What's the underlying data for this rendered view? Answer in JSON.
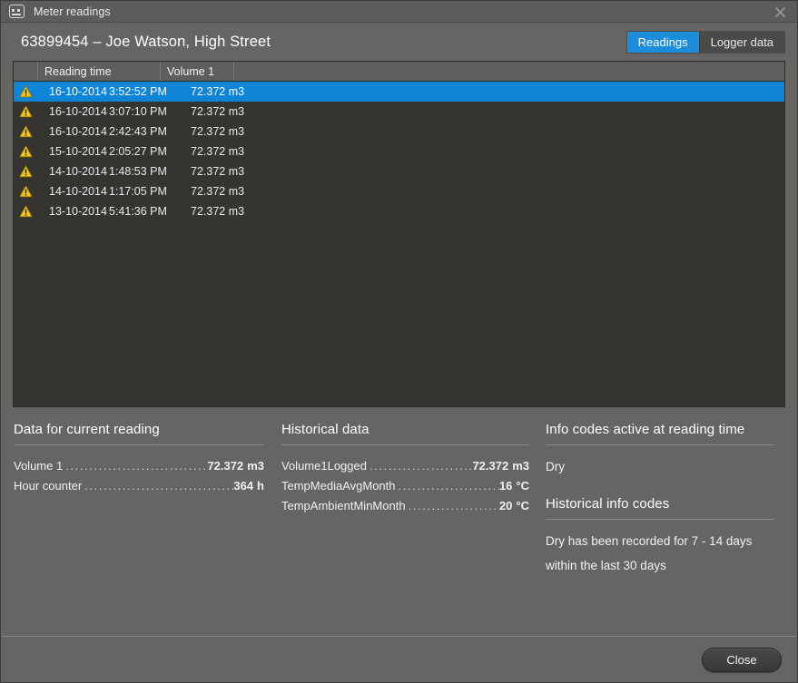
{
  "window": {
    "title": "Meter readings",
    "icon": "meter-icon",
    "close_icon": "close-icon"
  },
  "header": {
    "title": "63899454 – Joe Watson, High Street",
    "tabs": [
      {
        "label": "Readings",
        "active": true
      },
      {
        "label": "Logger data",
        "active": false
      }
    ]
  },
  "readings_table": {
    "columns": [
      "",
      "Reading time",
      "Volume 1",
      ""
    ],
    "rows": [
      {
        "status_icon": "warning-icon",
        "date": "16-10-2014",
        "time": "3:52:52 PM",
        "volume": "72.372 m3",
        "selected": true
      },
      {
        "status_icon": "warning-icon",
        "date": "16-10-2014",
        "time": "3:07:10 PM",
        "volume": "72.372 m3",
        "selected": false
      },
      {
        "status_icon": "warning-icon",
        "date": "16-10-2014",
        "time": "2:42:43 PM",
        "volume": "72.372 m3",
        "selected": false
      },
      {
        "status_icon": "warning-icon",
        "date": "15-10-2014",
        "time": "2:05:27 PM",
        "volume": "72.372 m3",
        "selected": false
      },
      {
        "status_icon": "warning-icon",
        "date": "14-10-2014",
        "time": "1:48:53 PM",
        "volume": "72.372 m3",
        "selected": false
      },
      {
        "status_icon": "warning-icon",
        "date": "14-10-2014",
        "time": "1:17:05 PM",
        "volume": "72.372 m3",
        "selected": false
      },
      {
        "status_icon": "warning-icon",
        "date": "13-10-2014",
        "time": "5:41:36 PM",
        "volume": "72.372 m3",
        "selected": false
      }
    ]
  },
  "current_reading": {
    "heading": "Data for current reading",
    "items": [
      {
        "label": "Volume 1",
        "value": "72.372",
        "unit": "m3"
      },
      {
        "label": "Hour counter",
        "value": "364",
        "unit": "h"
      }
    ]
  },
  "historical_data": {
    "heading": "Historical data",
    "items": [
      {
        "label": "Volume1Logged",
        "value": "72.372",
        "unit": "m3"
      },
      {
        "label": "TempMediaAvgMonth",
        "value": "16",
        "unit": "°C"
      },
      {
        "label": "TempAmbientMinMonth",
        "value": "20",
        "unit": "°C"
      }
    ]
  },
  "info_codes": {
    "heading": "Info codes active at reading time",
    "active": [
      "Dry"
    ],
    "historical_heading": "Historical info codes",
    "historical": [
      "Dry has been recorded for 7 - 14 days",
      "within the last 30 days"
    ]
  },
  "footer": {
    "close_label": "Close"
  },
  "colors": {
    "dialog_bg": "#666564",
    "titlebar_bg": "#5d5c5b",
    "list_bg": "#363430",
    "list_header_bg": "#5f5e5c",
    "selection_blue": "#0d84d6",
    "tab_active_blue": "#1b8ddb",
    "warning_yellow": "#f5c518",
    "rule": "#8b8a88"
  }
}
